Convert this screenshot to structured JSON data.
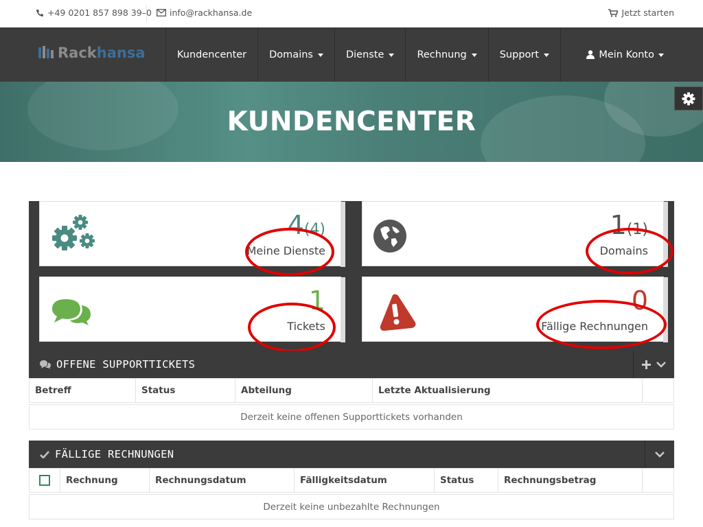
{
  "topbar": {
    "phone": "+49 0201 857 898 39–0",
    "email": "info@rackhansa.de",
    "start": "Jetzt starten"
  },
  "brand": {
    "part1": "Rack",
    "part2": "hansa"
  },
  "nav": {
    "items": [
      {
        "label": "Kundencenter",
        "dropdown": false
      },
      {
        "label": "Domains",
        "dropdown": true
      },
      {
        "label": "Dienste",
        "dropdown": true
      },
      {
        "label": "Rechnung",
        "dropdown": true
      },
      {
        "label": "Support",
        "dropdown": true
      }
    ],
    "account": "Mein Konto"
  },
  "hero": {
    "title": "KUNDENCENTER"
  },
  "tiles": [
    {
      "label": "Meine Dienste",
      "count": "4",
      "total": "(4)",
      "icon": "gears-icon",
      "color": "#4a8a82"
    },
    {
      "label": "Domains",
      "count": "1",
      "total": "(1)",
      "icon": "globe-icon",
      "color": "#555555"
    },
    {
      "label": "Tickets",
      "count": "1",
      "total": "",
      "icon": "comments-icon",
      "color": "#6ab04c"
    },
    {
      "label": "Fällige Rechnungen",
      "count": "0",
      "total": "",
      "icon": "warning-icon",
      "color": "#c0392b"
    }
  ],
  "tickets_panel": {
    "title": "OFFENE SUPPORTTICKETS",
    "columns": [
      "Betreff",
      "Status",
      "Abteilung",
      "Letzte Aktualisierung"
    ],
    "empty": "Derzeit keine offenen Supporttickets vorhanden"
  },
  "invoices_panel": {
    "title": "FÄLLIGE RECHNUNGEN",
    "columns": [
      "Rechnung",
      "Rechnungsdatum",
      "Fälligkeitsdatum",
      "Status",
      "Rechnungsbetrag"
    ],
    "empty": "Derzeit keine unbezahlte Rechnungen"
  },
  "colors": {
    "navbar": "#3c3c3c",
    "accent": "#4a8a82",
    "annotation": "#e00000"
  }
}
